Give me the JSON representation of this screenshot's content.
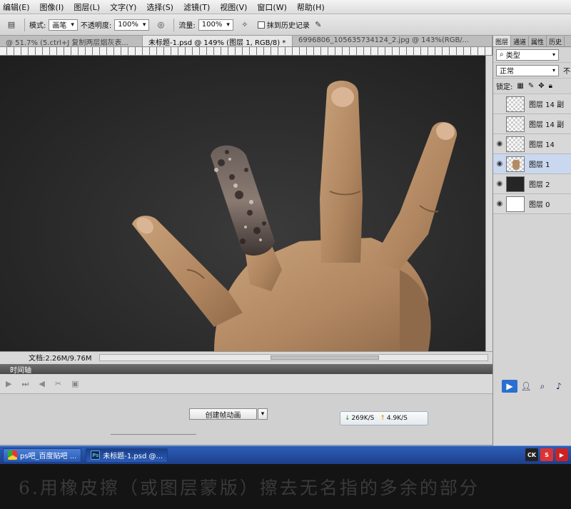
{
  "menu": {
    "items": [
      "编辑(E)",
      "图像(I)",
      "图层(L)",
      "文字(Y)",
      "选择(S)",
      "滤镜(T)",
      "视图(V)",
      "窗口(W)",
      "帮助(H)"
    ]
  },
  "options": {
    "mode_label": "模式:",
    "mode_value": "画笔",
    "opacity_label": "不透明度:",
    "opacity_value": "100%",
    "flow_label": "流量:",
    "flow_value": "100%",
    "erase_history_label": "抹到历史记录"
  },
  "tabs": [
    "@ 51.7% (5.ctrl+J 复制两层烟灰表...",
    "未标题-1.psd @ 149% (图层 1, RGB/8) *",
    "6996806_105635734124_2.jpg @ 143%(RGB/..."
  ],
  "status": {
    "doc_info": "文档:2.26M/9.76M"
  },
  "timeline": {
    "header": "时间轴",
    "create_animation_label": "创建帧动画",
    "net_down": "269K/S",
    "net_up": "4.9K/S"
  },
  "layers_panel": {
    "tabs": [
      "图层",
      "通道",
      "属性",
      "历史"
    ],
    "filter_label": "类型",
    "blend_mode": "正常",
    "blend_extra": "不",
    "lock_label": "锁定:",
    "layers": [
      {
        "name": "图层 14 副",
        "visible": false,
        "selected": false,
        "thumb": "trans"
      },
      {
        "name": "图层 14 副",
        "visible": false,
        "selected": false,
        "thumb": "trans"
      },
      {
        "name": "图层 14",
        "visible": true,
        "selected": false,
        "thumb": "trans"
      },
      {
        "name": "图层 1",
        "visible": true,
        "selected": true,
        "thumb": "hand"
      },
      {
        "name": "图层 2",
        "visible": true,
        "selected": false,
        "thumb": "dark"
      },
      {
        "name": "图层 0",
        "visible": true,
        "selected": false,
        "thumb": "white"
      }
    ]
  },
  "taskbar": {
    "tasks": [
      {
        "label": "ps吧_百度贴吧 ...",
        "icon": "chrome-icon"
      },
      {
        "label": "未标题-1.psd @...",
        "icon": "photoshop-icon"
      }
    ],
    "tray": [
      "CK",
      "S",
      "▶"
    ]
  },
  "caption": "6.用橡皮擦（或图层蒙版）擦去无名指的多余的部分",
  "colors": {
    "canvas_bg": "#262626",
    "skin": "#b89067",
    "taskbar": "#2d5fb8",
    "selected_layer": "#c9d8ee"
  }
}
